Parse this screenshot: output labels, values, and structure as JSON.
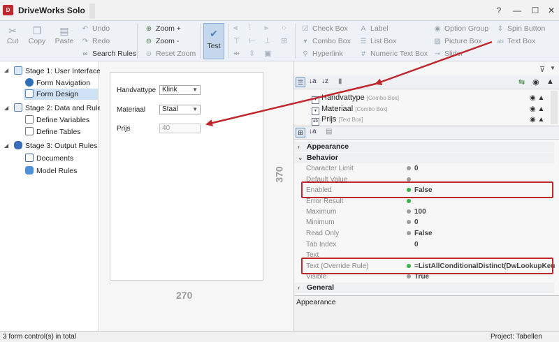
{
  "window": {
    "title": "DriveWorks Solo",
    "app_icon": "driveworks-logo",
    "controls": [
      "?",
      "—",
      "☐",
      "✕"
    ]
  },
  "ribbon": {
    "clipboard": [
      {
        "label": "Cut",
        "icon": "scissors-icon"
      },
      {
        "label": "Copy",
        "icon": "copy-icon"
      },
      {
        "label": "Paste",
        "icon": "paste-icon"
      }
    ],
    "edit": [
      {
        "label": "Undo",
        "icon": "undo-icon"
      },
      {
        "label": "Redo",
        "icon": "redo-icon"
      },
      {
        "label": "Search Rules",
        "icon": "binoculars-icon"
      }
    ],
    "zoom": [
      {
        "label": "Zoom +",
        "icon": "zoom-in-icon"
      },
      {
        "label": "Zoom -",
        "icon": "zoom-out-icon"
      },
      {
        "label": "Reset Zoom",
        "icon": "reset-zoom-icon"
      }
    ],
    "test": {
      "label": "Test",
      "icon": "test-icon"
    },
    "controls_col1": [
      {
        "label": "Check Box",
        "icon": "checkbox-icon"
      },
      {
        "label": "Combo Box",
        "icon": "combobox-icon"
      },
      {
        "label": "Hyperlink",
        "icon": "hyperlink-icon"
      }
    ],
    "controls_col2": [
      {
        "label": "Label",
        "icon": "label-icon"
      },
      {
        "label": "List Box",
        "icon": "listbox-icon"
      },
      {
        "label": "Numeric Text Box",
        "icon": "numeric-textbox-icon"
      }
    ],
    "controls_col3": [
      {
        "label": "Option Group",
        "icon": "option-group-icon"
      },
      {
        "label": "Picture Box",
        "icon": "picture-box-icon"
      },
      {
        "label": "Slider",
        "icon": "slider-icon"
      }
    ],
    "controls_col4": [
      {
        "label": "Spin Button",
        "icon": "spin-button-icon"
      },
      {
        "label": "Text Box",
        "icon": "textbox-icon"
      }
    ]
  },
  "tree": {
    "stage1": "Stage 1: User Interface",
    "form_navigation": "Form Navigation",
    "form_design": "Form Design",
    "stage2": "Stage 2: Data and Rules",
    "define_variables": "Define Variables",
    "define_tables": "Define Tables",
    "stage3": "Stage 3: Output Rules",
    "documents": "Documents",
    "model_rules": "Model Rules"
  },
  "form": {
    "fields": [
      {
        "label": "Handvattype",
        "value": "Klink",
        "type": "combo"
      },
      {
        "label": "Materiaal",
        "value": "Staal",
        "type": "combo"
      },
      {
        "label": "Prijs",
        "value": "40",
        "type": "text"
      }
    ],
    "height_label": "370",
    "width_label": "270"
  },
  "controls_list": [
    {
      "icon": "combobox-icon",
      "name": "Handvattype",
      "type": "[Combo Box]"
    },
    {
      "icon": "combobox-icon",
      "name": "Materiaal",
      "type": "[Combo Box]"
    },
    {
      "icon": "textbox-icon",
      "name": "Prijs",
      "type": "[Text Box]"
    }
  ],
  "properties": {
    "cat_appearance": "Appearance",
    "cat_behavior": "Behavior",
    "rows": [
      {
        "name": "Character Limit",
        "value": "0",
        "dot": "gray"
      },
      {
        "name": "Default Value",
        "value": "",
        "dot": "gray"
      },
      {
        "name": "Enabled",
        "value": "False",
        "dot": "green"
      },
      {
        "name": "Error Result",
        "value": "",
        "dot": "green"
      },
      {
        "name": "Maximum",
        "value": "100",
        "dot": "gray"
      },
      {
        "name": "Minimum",
        "value": "0",
        "dot": "gray"
      },
      {
        "name": "Read Only",
        "value": "False",
        "dot": "gray"
      },
      {
        "name": "Tab Index",
        "value": "0",
        "dot": "none"
      },
      {
        "name": "Text",
        "value": "",
        "dot": "none"
      },
      {
        "name": "Text (Override Rule)",
        "value": "=ListAllConditionalDistinct(DwLookupKeuze(",
        "dot": "green"
      },
      {
        "name": "Visible",
        "value": "True",
        "dot": "gray"
      }
    ],
    "cat_general": "General"
  },
  "description": "Appearance",
  "status": {
    "left": "3 form control(s) in total",
    "right": "Project: Tabellen"
  },
  "colors": {
    "highlight": "#c0272d",
    "selected": "#cfe1f5",
    "dot_green": "#3bb54a",
    "dot_gray": "#9c9c9c"
  }
}
